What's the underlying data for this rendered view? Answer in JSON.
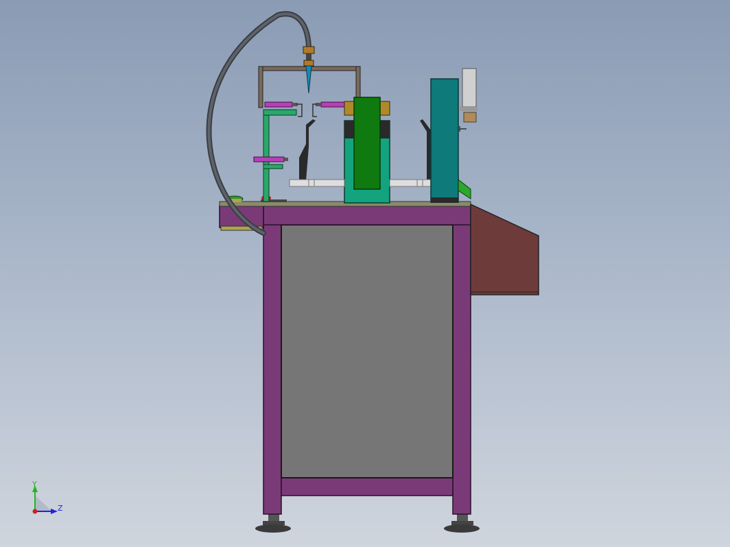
{
  "triad": {
    "y_label": "Y",
    "z_label": "Z",
    "y_color": "#1fb81f",
    "z_color": "#2222dd",
    "origin_color": "#cc2222"
  },
  "colors": {
    "background_top": "#8a9bb4",
    "background_bottom": "#cfd5dd",
    "frame": "#7a3a78",
    "panel": "#767676",
    "hose": "#555a60",
    "control_box": "#6e3b3b",
    "fixture_green": "#0f7a0f",
    "fixture_teal": "#14a37f",
    "column": "#0f7a7a",
    "bracket": "#7a6a5a",
    "cylinder": "#b83fb8",
    "mount_green": "#2aa86a",
    "brass": "#b08a2a",
    "nozzle": "#1a8ab0",
    "foot": "#3a3a3a"
  }
}
